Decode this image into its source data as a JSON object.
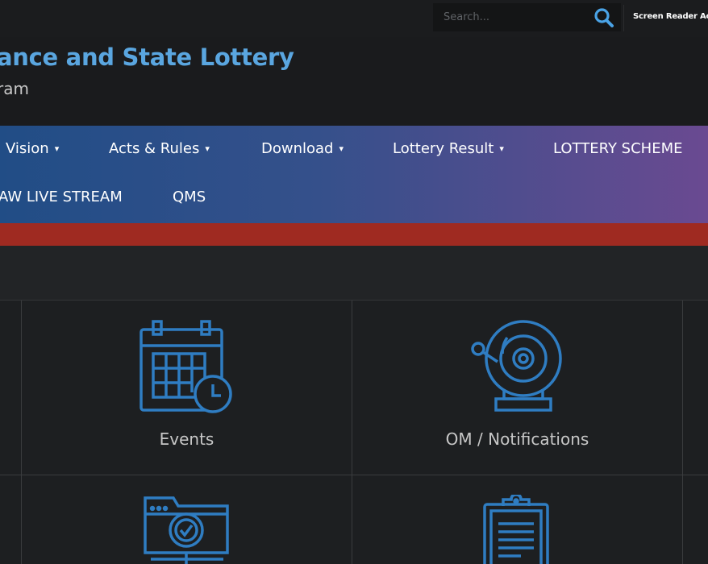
{
  "search": {
    "placeholder": "Search..."
  },
  "topbar": {
    "screen_reader_label": "Screen Reader Acc"
  },
  "header": {
    "title": "ance and State Lottery",
    "subtitle": "ram"
  },
  "nav": {
    "row1": [
      {
        "label": "Vision",
        "has_dropdown": true
      },
      {
        "label": "Acts & Rules",
        "has_dropdown": true
      },
      {
        "label": "Download",
        "has_dropdown": true
      },
      {
        "label": "Lottery Result",
        "has_dropdown": true
      },
      {
        "label": "LOTTERY SCHEME",
        "has_dropdown": false
      }
    ],
    "row2": [
      {
        "label": "AW LIVE STREAM",
        "has_dropdown": false
      },
      {
        "label": "QMS",
        "has_dropdown": false
      }
    ],
    "caret": "▾"
  },
  "tiles": [
    {
      "label": "Events",
      "icon": "calendar-icon"
    },
    {
      "label": "OM / Notifications",
      "icon": "bell-icon"
    },
    {
      "label": "",
      "icon": "folder-check-icon"
    },
    {
      "label": "",
      "icon": "clipboard-icon"
    }
  ],
  "colors": {
    "accent": "#5aa6e0",
    "icon_blue": "#2f7dc2",
    "red_bar": "#9f2a21",
    "nav_gradient_start": "#214d86",
    "nav_gradient_end": "#6a4a91"
  }
}
